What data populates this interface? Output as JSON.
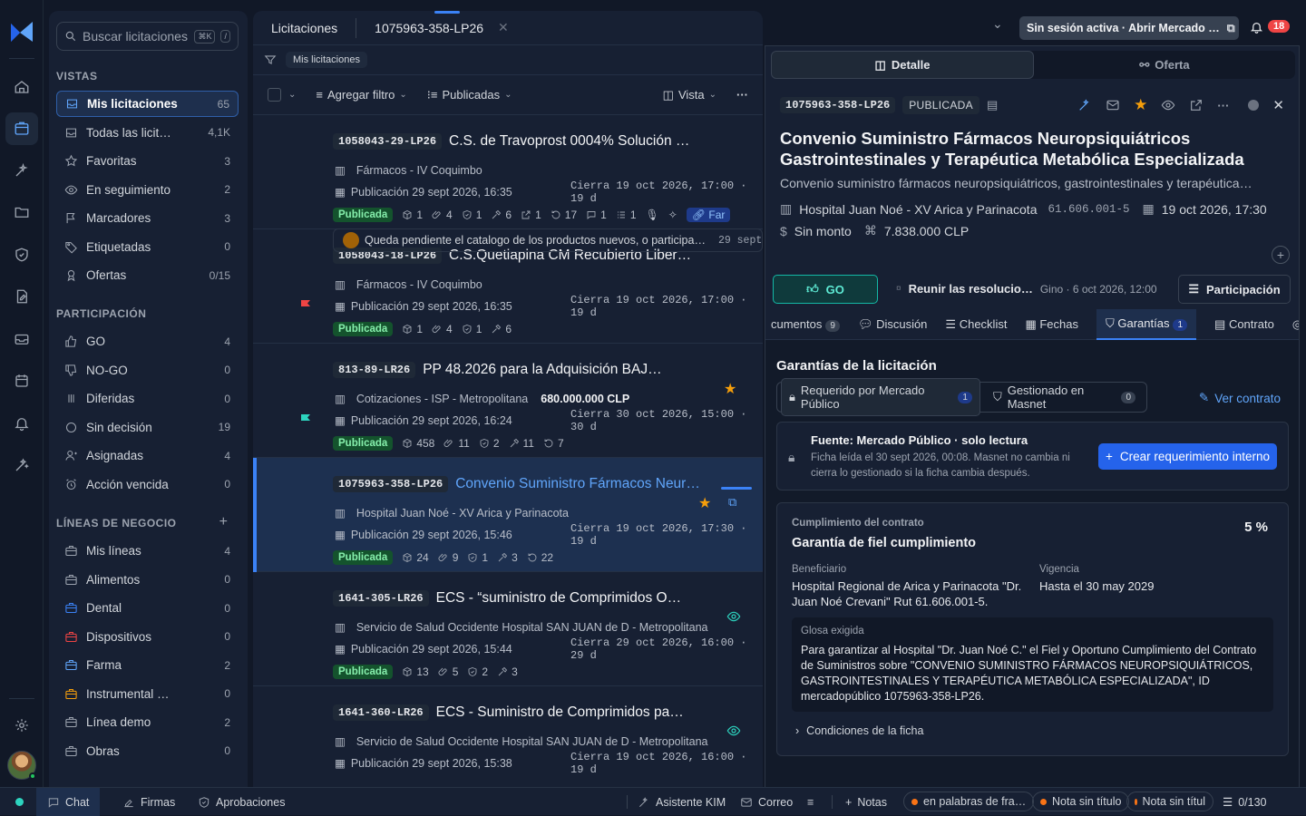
{
  "sidebar": {
    "search_placeholder": "Buscar licitaciones",
    "search_kbd1": "⌘K",
    "search_kbd2": "/",
    "vistas_title": "VISTAS",
    "vistas": [
      {
        "label": "Mis licitaciones",
        "count": "65",
        "icon": "inbox-icon"
      },
      {
        "label": "Todas las licit…",
        "count": "4,1K",
        "icon": "inbox-icon"
      },
      {
        "label": "Favoritas",
        "count": "3",
        "icon": "star-icon"
      },
      {
        "label": "En seguimiento",
        "count": "2",
        "icon": "eye-icon"
      },
      {
        "label": "Marcadores",
        "count": "3",
        "icon": "flag-icon"
      },
      {
        "label": "Etiquetadas",
        "count": "0",
        "icon": "tag-icon"
      },
      {
        "label": "Ofertas",
        "count": "0/15",
        "icon": "ribbon-icon"
      }
    ],
    "participacion_title": "PARTICIPACIÓN",
    "participacion": [
      {
        "label": "GO",
        "count": "4",
        "icon": "thumb-up-icon"
      },
      {
        "label": "NO-GO",
        "count": "0",
        "icon": "thumb-down-icon"
      },
      {
        "label": "Diferidas",
        "count": "0",
        "icon": "pause-icon"
      },
      {
        "label": "Sin decisión",
        "count": "19",
        "icon": "circle-icon"
      },
      {
        "label": "Asignadas",
        "count": "4",
        "icon": "user-icon"
      },
      {
        "label": "Acción vencida",
        "count": "0",
        "icon": "alarm-icon"
      }
    ],
    "lineas_title": "LÍNEAS DE NEGOCIO",
    "lineas": [
      {
        "label": "Mis líneas",
        "count": "4",
        "color": "#9ca3af"
      },
      {
        "label": "Alimentos",
        "count": "0",
        "color": "#9ca3af"
      },
      {
        "label": "Dental",
        "count": "0",
        "color": "#3b82f6"
      },
      {
        "label": "Dispositivos",
        "count": "0",
        "color": "#ef4444"
      },
      {
        "label": "Farma",
        "count": "2",
        "color": "#60a5fa"
      },
      {
        "label": "Instrumental …",
        "count": "0",
        "color": "#f59e0b"
      },
      {
        "label": "Línea demo",
        "count": "2",
        "color": "#9ca3af"
      },
      {
        "label": "Obras",
        "count": "0",
        "color": "#9ca3af"
      }
    ]
  },
  "list": {
    "tab1": "Licitaciones",
    "tab2": "1075963-358-LP26",
    "filter_chip": "Mis licitaciones",
    "add_filter": "Agregar filtro",
    "published": "Publicadas",
    "view": "Vista",
    "cards": [
      {
        "code": "1058043-29-LP26",
        "title": "C.S. de Travoprost 0004% Solución Oft…",
        "org": "Fármacos - IV Coquimbo",
        "amount": "",
        "pub": "Publicación 29 sept 2026, 16:35",
        "close": "Cierra 19 oct 2026, 17:00 · 19 d",
        "status": "Publicada",
        "stats": [
          "1",
          "4",
          "1",
          "6",
          "1",
          "17",
          "1",
          "1"
        ],
        "tag": "Far",
        "note": "Queda pendiente el catalogo de los productos nuevos, o participa…",
        "note_date": "29 sept 2("
      },
      {
        "code": "1058043-18-LP26",
        "title": "C.S.Quetiapina CM Recubierto Liberaci…",
        "org": "Fármacos - IV Coquimbo",
        "amount": "",
        "pub": "Publicación 29 sept 2026, 16:35",
        "close": "Cierra 19 oct 2026, 17:00 · 19 d",
        "status": "Publicada",
        "stats": [
          "1",
          "4",
          "1",
          "6"
        ]
      },
      {
        "code": "813-89-LR26",
        "title": "PP 48.2026 para la Adquisición BAJO Modal…",
        "org": "Cotizaciones - ISP - Metropolitana",
        "amount": "680.000.000 CLP",
        "pub": "Publicación 29 sept 2026, 16:24",
        "close": "Cierra 30 oct 2026, 15:00 · 30 d",
        "status": "Publicada",
        "stats": [
          "458",
          "11",
          "2",
          "11",
          "7"
        ]
      },
      {
        "code": "1075963-358-LP26",
        "title": "Convenio Suministro Fármacos Neuro…",
        "org": "Hospital Juan Noé - XV Arica y Parinacota",
        "amount": "",
        "pub": "Publicación 29 sept 2026, 15:46",
        "close": "Cierra 19 oct 2026, 17:30 · 19 d",
        "status": "Publicada",
        "stats": [
          "24",
          "9",
          "1",
          "3",
          "22"
        ]
      },
      {
        "code": "1641-305-LR26",
        "title": "ECS - “suministro de Comprimidos Orales…",
        "org": "Servicio de Salud Occidente Hospital SAN JUAN de D - Metropolitana",
        "amount": "",
        "pub": "Publicación 29 sept 2026, 15:44",
        "close": "Cierra 29 oct 2026, 16:00 · 29 d",
        "status": "Publicada",
        "stats": [
          "13",
          "5",
          "2",
          "3"
        ]
      },
      {
        "code": "1641-360-LR26",
        "title": "ECS - Suministro de Comprimidos para F…",
        "org": "Servicio de Salud Occidente Hospital SAN JUAN de D - Metropolitana",
        "amount": "",
        "pub": "Publicación 29 sept 2026, 15:38",
        "close": "Cierra 19 oct 2026, 16:00 · 19 d",
        "status": "Publicada",
        "stats": []
      }
    ]
  },
  "header": {
    "session": "Sin sesión activa · Abrir Mercado …",
    "notif_count": "18"
  },
  "detail": {
    "tab_detalle": "Detalle",
    "tab_oferta": "Oferta",
    "code": "1075963-358-LP26",
    "status": "PUBLICADA",
    "title": "Convenio Suministro Fármacos Neuropsiquiátricos Gastrointestinales y Terapéutica Metabólica Especializada",
    "subtitle": "Convenio suministro fármacos neuropsiquiátricos, gastrointestinales y terapéutica…",
    "org": "Hospital Juan Noé - XV Arica y Parinacota",
    "rut": "61.606.001-5",
    "deadline": "19 oct 2026, 17:30",
    "monto": "Sin monto",
    "amount": "7.838.000 CLP",
    "go": "GO",
    "task": "Reunir las resolucio…",
    "task_meta": "Gino · 6 oct 2026, 12:00",
    "participacion": "Participación",
    "subtabs": {
      "docs": "cumentos",
      "docs_count": "9",
      "discusion": "Discusión",
      "checklist": "Checklist",
      "fechas": "Fechas",
      "garantias": "Garantías",
      "garantias_count": "1",
      "contrato": "Contrato",
      "cr": "Cr"
    },
    "garantias_title": "Garantías de la licitación",
    "req_mp": "Requerido por Mercado Público",
    "req_mp_count": "1",
    "gest": "Gestionado en Masnet",
    "gest_count": "0",
    "ver_contrato": "Ver contrato",
    "fuente_title": "Fuente: Mercado Público · solo lectura",
    "fuente_desc": "Ficha leída el 30 sept 2026, 00:08. Masnet no cambia ni cierra lo gestionado si la ficha cambia después.",
    "crear_btn": "Crear requerimiento interno",
    "cumpl_label": "Cumplimiento del contrato",
    "cumpl_title": "Garantía de fiel cumplimiento",
    "pct": "5 %",
    "benef_label": "Beneficiario",
    "benef": "Hospital Regional de Arica y Parinacota \"Dr. Juan Noé Crevani\" Rut 61.606.001-5.",
    "vig_label": "Vigencia",
    "vig": "Hasta el 30 may 2029",
    "glosa_label": "Glosa exigida",
    "glosa": "Para garantizar al Hospital \"Dr. Juan Noé C.\" el Fiel y Oportuno Cumplimiento del Contrato de Suministros sobre \"CONVENIO SUMINISTRO FÁRMACOS NEUROPSIQUIÁTRICOS, GASTROINTESTINALES Y TERAPÉUTICA METABÓLICA ESPECIALIZADA\", ID mercadopúblico 1075963-358-LP26.",
    "condiciones": "Condiciones de la ficha"
  },
  "bottom": {
    "chat": "Chat",
    "firmas": "Firmas",
    "aprob": "Aprobaciones",
    "kim": "Asistente KIM",
    "correo": "Correo",
    "notas": "Notas",
    "n1": "en palabras de fra…",
    "n2": "Nota sin título",
    "n3": "Nota sin títul",
    "count": "0/130"
  },
  "colors": {
    "accent": "#3b82f6",
    "go": "#14b8a6",
    "published": "#86efac",
    "star": "#f59e0b",
    "flag_red": "#ef4444",
    "flag_teal": "#2dd4bf"
  }
}
